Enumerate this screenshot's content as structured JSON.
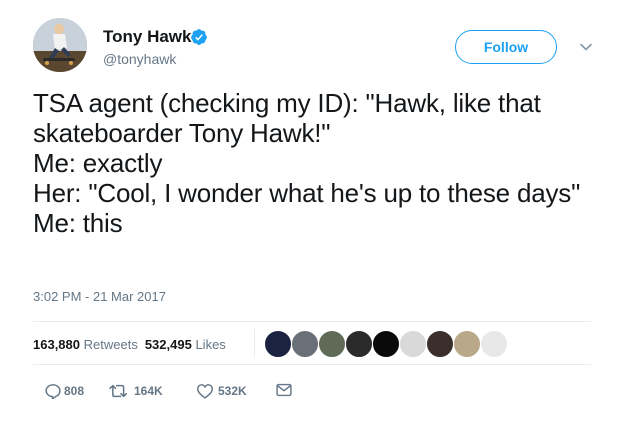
{
  "author": {
    "name": "Tony Hawk",
    "handle": "@tonyhawk",
    "verified": true,
    "avatar_icon": "skateboarder-avatar-photo"
  },
  "follow": {
    "label": "Follow",
    "color": "#1da1f2"
  },
  "tweet": {
    "text": "TSA agent (checking my ID): \"Hawk, like that skateboarder Tony Hawk!\"\nMe: exactly\nHer: \"Cool, I wonder what he's up to these days\"\nMe: this",
    "timestamp": "3:02 PM - 21 Mar 2017"
  },
  "stats": {
    "retweets_count": "163,880",
    "retweets_label": "Retweets",
    "likes_count": "532,495",
    "likes_label": "Likes"
  },
  "likers": [
    {
      "icon": "liker-avatar-1",
      "color": "#1b2340"
    },
    {
      "icon": "liker-avatar-2",
      "color": "#6b6f78"
    },
    {
      "icon": "liker-avatar-3",
      "color": "#5f6b57"
    },
    {
      "icon": "liker-avatar-4",
      "color": "#2b2b2b"
    },
    {
      "icon": "liker-avatar-5",
      "color": "#0a0a0a"
    },
    {
      "icon": "liker-avatar-6",
      "color": "#d9d9d9"
    },
    {
      "icon": "liker-avatar-7",
      "color": "#3a2f2a"
    },
    {
      "icon": "liker-avatar-8",
      "color": "#b9a98a"
    },
    {
      "icon": "liker-avatar-9",
      "color": "#e8e8e8"
    }
  ],
  "actions": {
    "reply_icon": "reply-icon",
    "reply_count": "808",
    "retweet_icon": "retweet-icon",
    "retweet_count": "164K",
    "like_icon": "heart-icon",
    "like_count": "532K",
    "message_icon": "envelope-icon"
  }
}
